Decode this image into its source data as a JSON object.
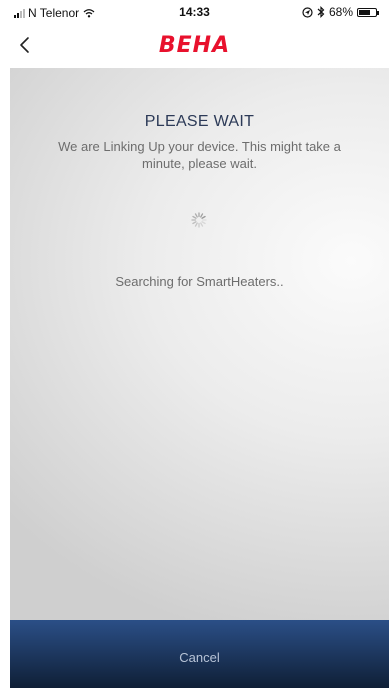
{
  "status_bar": {
    "carrier": "N Telenor",
    "time": "14:33",
    "battery_percent": "68%",
    "battery_level": 0.68,
    "icons": [
      "signal-icon",
      "wifi-icon",
      "location-icon",
      "bluetooth-icon",
      "battery-icon"
    ]
  },
  "nav": {
    "back_icon": "chevron-left-icon",
    "logo_text": "BEHA",
    "logo_color": "#e8112d"
  },
  "content": {
    "title": "PLEASE WAIT",
    "message": "We are Linking Up your device. This might take a minute, please wait.",
    "spinner_icon": "loading-spinner-icon",
    "status_text": "Searching for SmartHeaters.."
  },
  "footer": {
    "cancel_label": "Cancel",
    "bar_color": "#1d3a66"
  },
  "colors": {
    "title": "#2c3a57",
    "body_text": "#6d6d6d"
  }
}
